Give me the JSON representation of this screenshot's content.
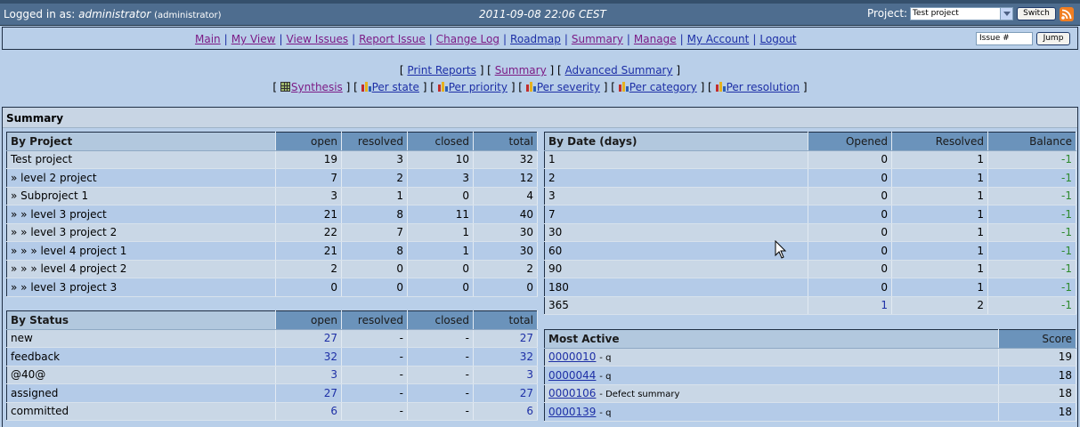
{
  "login": {
    "prefix": "Logged in as:",
    "user": "administrator",
    "role": "(administrator)",
    "datetime": "2011-09-08 22:06 CEST",
    "project_label": "Project:",
    "project_selected": "Test project",
    "switch_label": "Switch"
  },
  "menu": {
    "items": [
      "Main",
      "My View",
      "View Issues",
      "Report Issue",
      "Change Log",
      "Roadmap",
      "Summary",
      "Manage",
      "My Account",
      "Logout"
    ],
    "jump_value": "Issue #",
    "jump_label": "Jump"
  },
  "sublinks": {
    "print_reports": "Print Reports",
    "summary": "Summary",
    "advanced_summary": "Advanced Summary",
    "synthesis": "Synthesis",
    "per_state": "Per state",
    "per_priority": "Per priority",
    "per_severity": "Per severity",
    "per_category": "Per category",
    "per_resolution": "Per resolution"
  },
  "summary_title": "Summary",
  "by_project": {
    "caption": "By Project",
    "headers": [
      "open",
      "resolved",
      "closed",
      "total"
    ],
    "rows": [
      [
        "Test project",
        "19",
        "3",
        "10",
        "32"
      ],
      [
        "» level 2 project",
        "7",
        "2",
        "3",
        "12"
      ],
      [
        "» Subproject 1",
        "3",
        "1",
        "0",
        "4"
      ],
      [
        "» » level 3 project",
        "21",
        "8",
        "11",
        "40"
      ],
      [
        "» » level 3 project 2",
        "22",
        "7",
        "1",
        "30"
      ],
      [
        "» » » level 4 project 1",
        "21",
        "8",
        "1",
        "30"
      ],
      [
        "» » » level 4 project 2",
        "2",
        "0",
        "0",
        "2"
      ],
      [
        "» » level 3 project 3",
        "0",
        "0",
        "0",
        "0"
      ]
    ]
  },
  "by_status": {
    "caption": "By Status",
    "headers": [
      "open",
      "resolved",
      "closed",
      "total"
    ],
    "rows": [
      [
        "new",
        "27",
        "-",
        "-",
        "27"
      ],
      [
        "feedback",
        "32",
        "-",
        "-",
        "32"
      ],
      [
        "@40@",
        "3",
        "-",
        "-",
        "3"
      ],
      [
        "assigned",
        "27",
        "-",
        "-",
        "27"
      ],
      [
        "committed",
        "6",
        "-",
        "-",
        "6"
      ]
    ]
  },
  "by_date": {
    "caption": "By Date (days)",
    "headers": [
      "Opened",
      "Resolved",
      "Balance"
    ],
    "rows": [
      [
        "1",
        "0",
        "1",
        "-1"
      ],
      [
        "2",
        "0",
        "1",
        "-1"
      ],
      [
        "3",
        "0",
        "1",
        "-1"
      ],
      [
        "7",
        "0",
        "1",
        "-1"
      ],
      [
        "30",
        "0",
        "1",
        "-1"
      ],
      [
        "60",
        "0",
        "1",
        "-1"
      ],
      [
        "90",
        "0",
        "1",
        "-1"
      ],
      [
        "180",
        "0",
        "1",
        "-1"
      ],
      [
        "365",
        "1",
        "2",
        "-1"
      ]
    ]
  },
  "most_active": {
    "caption": "Most Active",
    "header": "Score",
    "rows": [
      [
        "0000010",
        "- q",
        "19"
      ],
      [
        "0000044",
        "- q",
        "18"
      ],
      [
        "0000106",
        "- Defect summary",
        "18"
      ],
      [
        "0000139",
        "- q",
        "18"
      ]
    ]
  }
}
